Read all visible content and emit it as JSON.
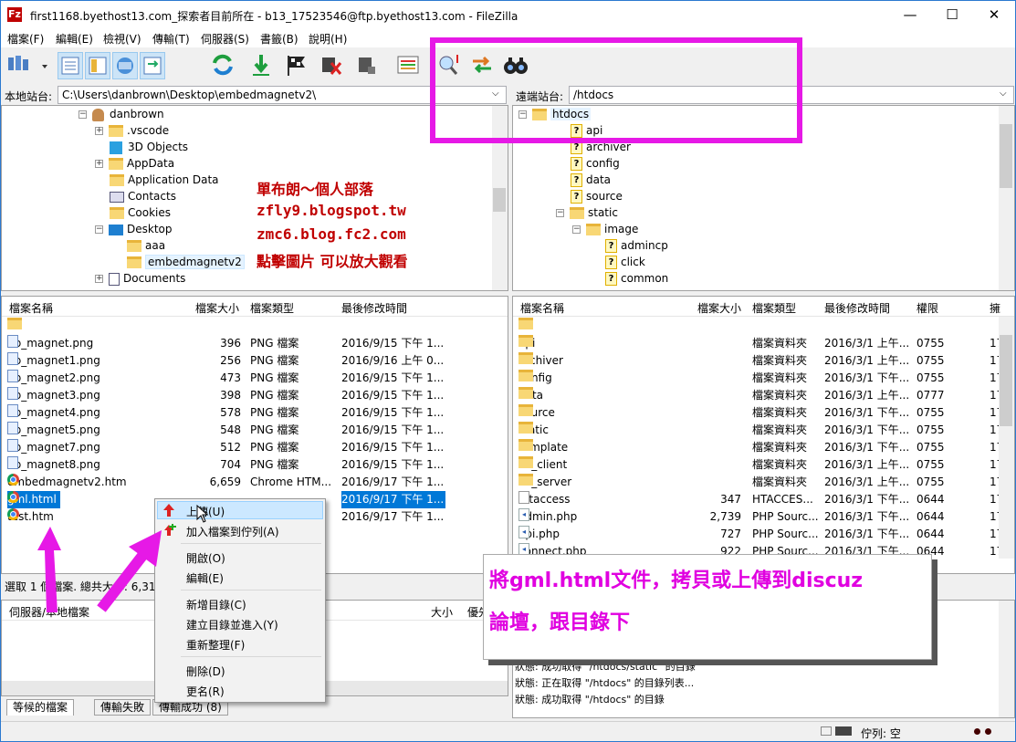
{
  "window": {
    "app_icon": "Fz",
    "title": "first1168.byethost13.com_探索者目前所在 - b13_17523546@ftp.byethost13.com - FileZilla",
    "minimize": "—",
    "maximize": "☐",
    "close": "✕"
  },
  "menu": [
    "檔案(F)",
    "編輯(E)",
    "檢視(V)",
    "傳輸(T)",
    "伺服器(S)",
    "書籤(B)",
    "說明(H)"
  ],
  "toolbar": {
    "icons": [
      "site-manager-icon",
      "message-log-icon",
      "local-tree-icon",
      "remote-tree-icon",
      "transfer-queue-icon",
      "refresh-icon",
      "process-queue-icon",
      "cancel-icon",
      "disconnect-icon",
      "reconnect-icon",
      "directory-compare-icon",
      "filter-icon",
      "sync-browse-icon",
      "find-files-icon"
    ]
  },
  "local": {
    "address_label": "本地站台:",
    "address_value": "C:\\Users\\danbrown\\Desktop\\embedmagnetv2\\",
    "tree": [
      {
        "label": "danbrown",
        "icon": "user-icon"
      },
      {
        "label": ".vscode",
        "icon": "folder-icon"
      },
      {
        "label": "3D Objects",
        "icon": "3d-objects-icon"
      },
      {
        "label": "AppData",
        "icon": "folder-icon"
      },
      {
        "label": "Application Data",
        "icon": "folder-icon"
      },
      {
        "label": "Contacts",
        "icon": "contacts-icon"
      },
      {
        "label": "Cookies",
        "icon": "folder-icon"
      },
      {
        "label": "Desktop",
        "icon": "desktop-icon"
      },
      {
        "label": "aaa",
        "icon": "folder-icon"
      },
      {
        "label": "embedmagnetv2",
        "icon": "folder-icon"
      },
      {
        "label": "Documents",
        "icon": "documents-icon"
      }
    ],
    "columns": [
      "檔案名稱",
      "檔案大小",
      "檔案類型",
      "最後修改時間"
    ],
    "files": [
      {
        "name": "..",
        "size": "",
        "type": "",
        "modified": ""
      },
      {
        "name": "bb_magnet.png",
        "size": "396",
        "type": "PNG 檔案",
        "modified": "2016/9/15 下午 1..."
      },
      {
        "name": "bb_magnet1.png",
        "size": "256",
        "type": "PNG 檔案",
        "modified": "2016/9/16 上午 0..."
      },
      {
        "name": "bb_magnet2.png",
        "size": "473",
        "type": "PNG 檔案",
        "modified": "2016/9/15 下午 1..."
      },
      {
        "name": "bb_magnet3.png",
        "size": "398",
        "type": "PNG 檔案",
        "modified": "2016/9/15 下午 1..."
      },
      {
        "name": "bb_magnet4.png",
        "size": "578",
        "type": "PNG 檔案",
        "modified": "2016/9/15 下午 1..."
      },
      {
        "name": "bb_magnet5.png",
        "size": "548",
        "type": "PNG 檔案",
        "modified": "2016/9/15 下午 1..."
      },
      {
        "name": "bb_magnet7.png",
        "size": "512",
        "type": "PNG 檔案",
        "modified": "2016/9/15 下午 1..."
      },
      {
        "name": "bb_magnet8.png",
        "size": "704",
        "type": "PNG 檔案",
        "modified": "2016/9/15 下午 1..."
      },
      {
        "name": "embedmagnetv2.htm",
        "size": "6,659",
        "type": "Chrome HTM...",
        "modified": "2016/9/17 下午 1..."
      },
      {
        "name": "gml.html",
        "size": "",
        "type": "",
        "modified": "2016/9/17 下午 1..."
      },
      {
        "name": "test.htm",
        "size": "",
        "type": "",
        "modified": "2016/9/17 下午 1..."
      }
    ],
    "status": "選取 1 個檔案. 總共大小: 6,315"
  },
  "remote": {
    "address_label": "遠端站台:",
    "address_value": "/htdocs",
    "tree": [
      {
        "label": "htdocs",
        "icon": "folder-icon"
      },
      {
        "label": "api",
        "icon": "unknown-folder-icon"
      },
      {
        "label": "archiver",
        "icon": "unknown-folder-icon"
      },
      {
        "label": "config",
        "icon": "unknown-folder-icon"
      },
      {
        "label": "data",
        "icon": "unknown-folder-icon"
      },
      {
        "label": "source",
        "icon": "unknown-folder-icon"
      },
      {
        "label": "static",
        "icon": "folder-icon"
      },
      {
        "label": "image",
        "icon": "folder-icon"
      },
      {
        "label": "admincp",
        "icon": "unknown-folder-icon"
      },
      {
        "label": "click",
        "icon": "unknown-folder-icon"
      },
      {
        "label": "common",
        "icon": "unknown-folder-icon"
      }
    ],
    "columns": [
      "檔案名稱",
      "檔案大小",
      "檔案類型",
      "最後修改時間",
      "權限",
      "擁"
    ],
    "files": [
      {
        "name": "..",
        "size": "",
        "type": "",
        "modified": "",
        "perm": "",
        "owner": ""
      },
      {
        "name": "api",
        "size": "",
        "type": "檔案資料夾",
        "modified": "2016/3/1 上午...",
        "perm": "0755",
        "owner": "17"
      },
      {
        "name": "archiver",
        "size": "",
        "type": "檔案資料夾",
        "modified": "2016/3/1 上午...",
        "perm": "0755",
        "owner": "17"
      },
      {
        "name": "config",
        "size": "",
        "type": "檔案資料夾",
        "modified": "2016/3/1 下午...",
        "perm": "0755",
        "owner": "17"
      },
      {
        "name": "data",
        "size": "",
        "type": "檔案資料夾",
        "modified": "2016/3/1 上午...",
        "perm": "0777",
        "owner": "17"
      },
      {
        "name": "source",
        "size": "",
        "type": "檔案資料夾",
        "modified": "2016/3/1 下午...",
        "perm": "0755",
        "owner": "17"
      },
      {
        "name": "static",
        "size": "",
        "type": "檔案資料夾",
        "modified": "2016/3/1 下午...",
        "perm": "0755",
        "owner": "17"
      },
      {
        "name": "template",
        "size": "",
        "type": "檔案資料夾",
        "modified": "2016/3/1 下午...",
        "perm": "0755",
        "owner": "17"
      },
      {
        "name": "uc_client",
        "size": "",
        "type": "檔案資料夾",
        "modified": "2016/3/1 上午...",
        "perm": "0755",
        "owner": "17"
      },
      {
        "name": "uc_server",
        "size": "",
        "type": "檔案資料夾",
        "modified": "2016/3/1 上午...",
        "perm": "0755",
        "owner": "17"
      },
      {
        "name": ".htaccess",
        "size": "347",
        "type": "HTACCES...",
        "modified": "2016/3/1 下午...",
        "perm": "0644",
        "owner": "17"
      },
      {
        "name": "admin.php",
        "size": "2,739",
        "type": "PHP Sourc...",
        "modified": "2016/3/1 下午...",
        "perm": "0644",
        "owner": "17"
      },
      {
        "name": "api.php",
        "size": "727",
        "type": "PHP Sourc...",
        "modified": "2016/3/1 下午...",
        "perm": "0644",
        "owner": "17"
      },
      {
        "name": "connect.php",
        "size": "922",
        "type": "PHP Sourc...",
        "modified": "2016/3/1 下午...",
        "perm": "0644",
        "owner": "17"
      }
    ]
  },
  "queue": {
    "header_left": "伺服器/本地檔案",
    "header_size": "大小",
    "header_priority": "優先",
    "tabs": [
      "等候的檔案",
      "傳輸失敗",
      "傳輸成功 (8)"
    ]
  },
  "log": [
    "狀態:   成功取得 \"/htdocs/static\" 的目錄",
    "狀態:   正在取得 \"/htdocs\" 的目錄列表...",
    "狀態:   成功取得 \"/htdocs\" 的目錄"
  ],
  "statusbar": {
    "queue": "佇列: 空"
  },
  "context_menu": {
    "items": [
      {
        "label": "上傳(U)",
        "icon": "upload-icon",
        "highlight": true
      },
      {
        "label": "加入檔案到佇列(A)",
        "icon": "add-to-queue-icon"
      },
      {
        "sep": true
      },
      {
        "label": "開啟(O)"
      },
      {
        "label": "編輯(E)"
      },
      {
        "sep": true
      },
      {
        "label": "新增目錄(C)"
      },
      {
        "label": "建立目錄並進入(Y)"
      },
      {
        "label": "重新整理(F)"
      },
      {
        "sep": true
      },
      {
        "label": "刪除(D)"
      },
      {
        "label": "更名(R)"
      }
    ]
  },
  "annotations": {
    "blog_lines": [
      "單布朗～個人部落",
      "zfly9.blogspot.tw",
      "zmc6.blog.fc2.com",
      "點擊圖片 可以放大觀看"
    ],
    "callout_lines": [
      "將gml.html文件，拷貝或上傳到discuz",
      "論壇，跟目錄下"
    ],
    "highlight_color": "#e619e6",
    "blog_color": "#c00000"
  }
}
